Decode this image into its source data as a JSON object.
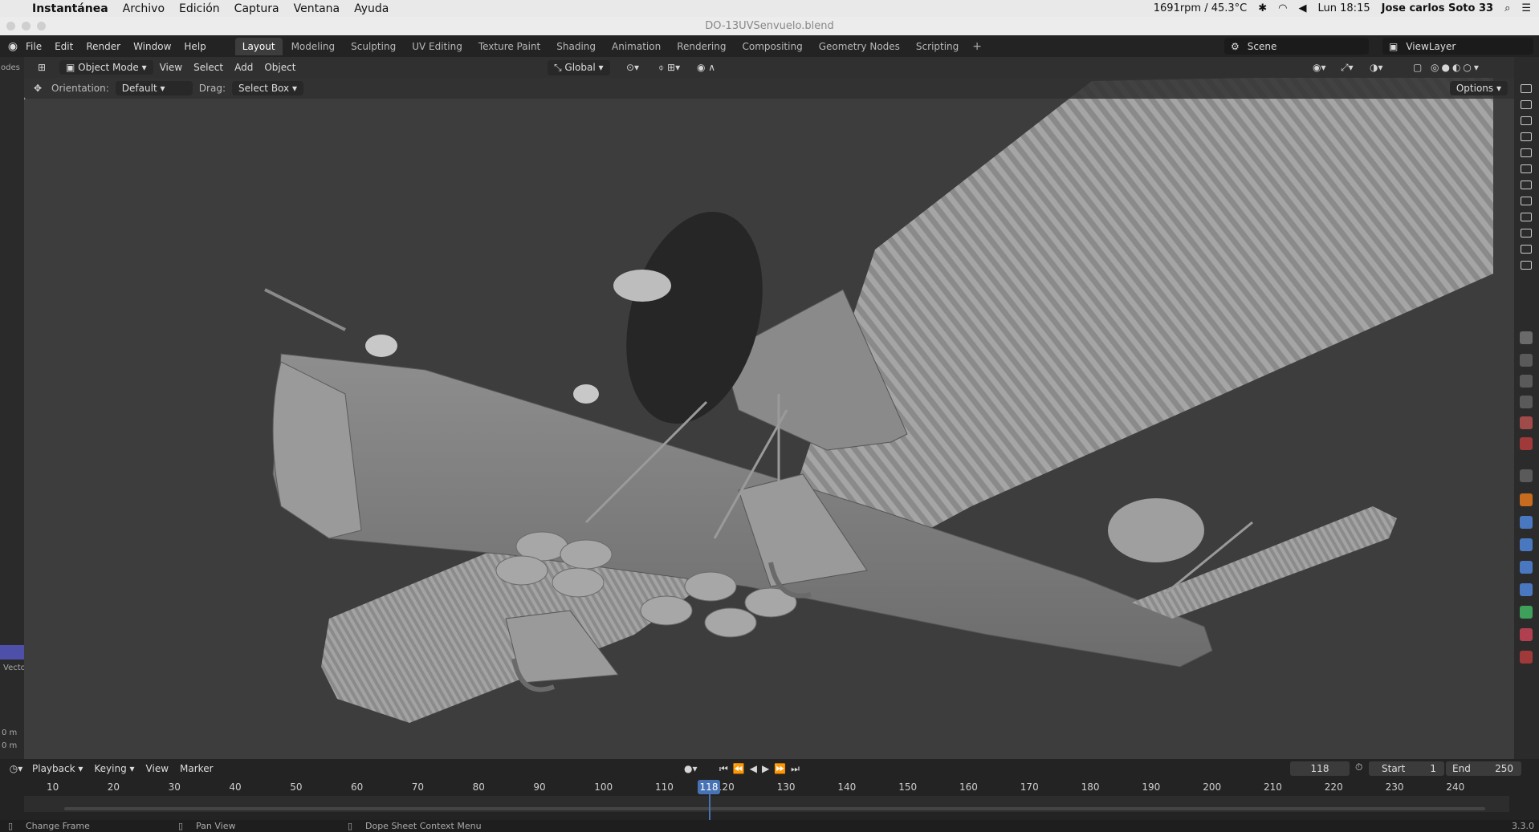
{
  "mac": {
    "app": "Instantánea",
    "menus": [
      "Archivo",
      "Edición",
      "Captura",
      "Ventana",
      "Ayuda"
    ],
    "status_fan": "1691rpm / 45.3°C",
    "clock": "Lun 18:15",
    "user": "Jose carlos Soto 33"
  },
  "window": {
    "title": "DO-13UVSenvuelo.blend"
  },
  "blender": {
    "menus": [
      "File",
      "Edit",
      "Render",
      "Window",
      "Help"
    ],
    "workspaces": [
      "Layout",
      "Modeling",
      "Sculpting",
      "UV Editing",
      "Texture Paint",
      "Shading",
      "Animation",
      "Rendering",
      "Compositing",
      "Geometry Nodes",
      "Scripting"
    ],
    "active_workspace": "Layout",
    "scene": "Scene",
    "view_layer": "ViewLayer"
  },
  "viewport": {
    "mode": "Object Mode",
    "menus": [
      "View",
      "Select",
      "Add",
      "Object"
    ],
    "transform": "Global",
    "orientation_label": "Orientation:",
    "orientation": "Default",
    "drag_label": "Drag:",
    "drag": "Select Box",
    "options": "Options"
  },
  "leftstrip": {
    "label_top": "odes",
    "label_vec": "Vecto",
    "label_m1": "0 m",
    "label_m2": "0 m"
  },
  "timeline": {
    "menus": [
      "Playback",
      "Keying",
      "View",
      "Marker"
    ],
    "current_frame": "118",
    "start_label": "Start",
    "start": "1",
    "end_label": "End",
    "end": "250",
    "ticks": [
      "10",
      "20",
      "30",
      "40",
      "50",
      "60",
      "70",
      "80",
      "90",
      "100",
      "110",
      "120",
      "130",
      "140",
      "150",
      "160",
      "170",
      "180",
      "190",
      "200",
      "210",
      "220",
      "230",
      "240"
    ]
  },
  "status": {
    "change_frame": "Change Frame",
    "pan_view": "Pan View",
    "context": "Dope Sheet Context Menu",
    "version": "3.3.0"
  },
  "colors": {
    "accent": "#4772b3",
    "viewport_bg": "#3d3d3d"
  }
}
